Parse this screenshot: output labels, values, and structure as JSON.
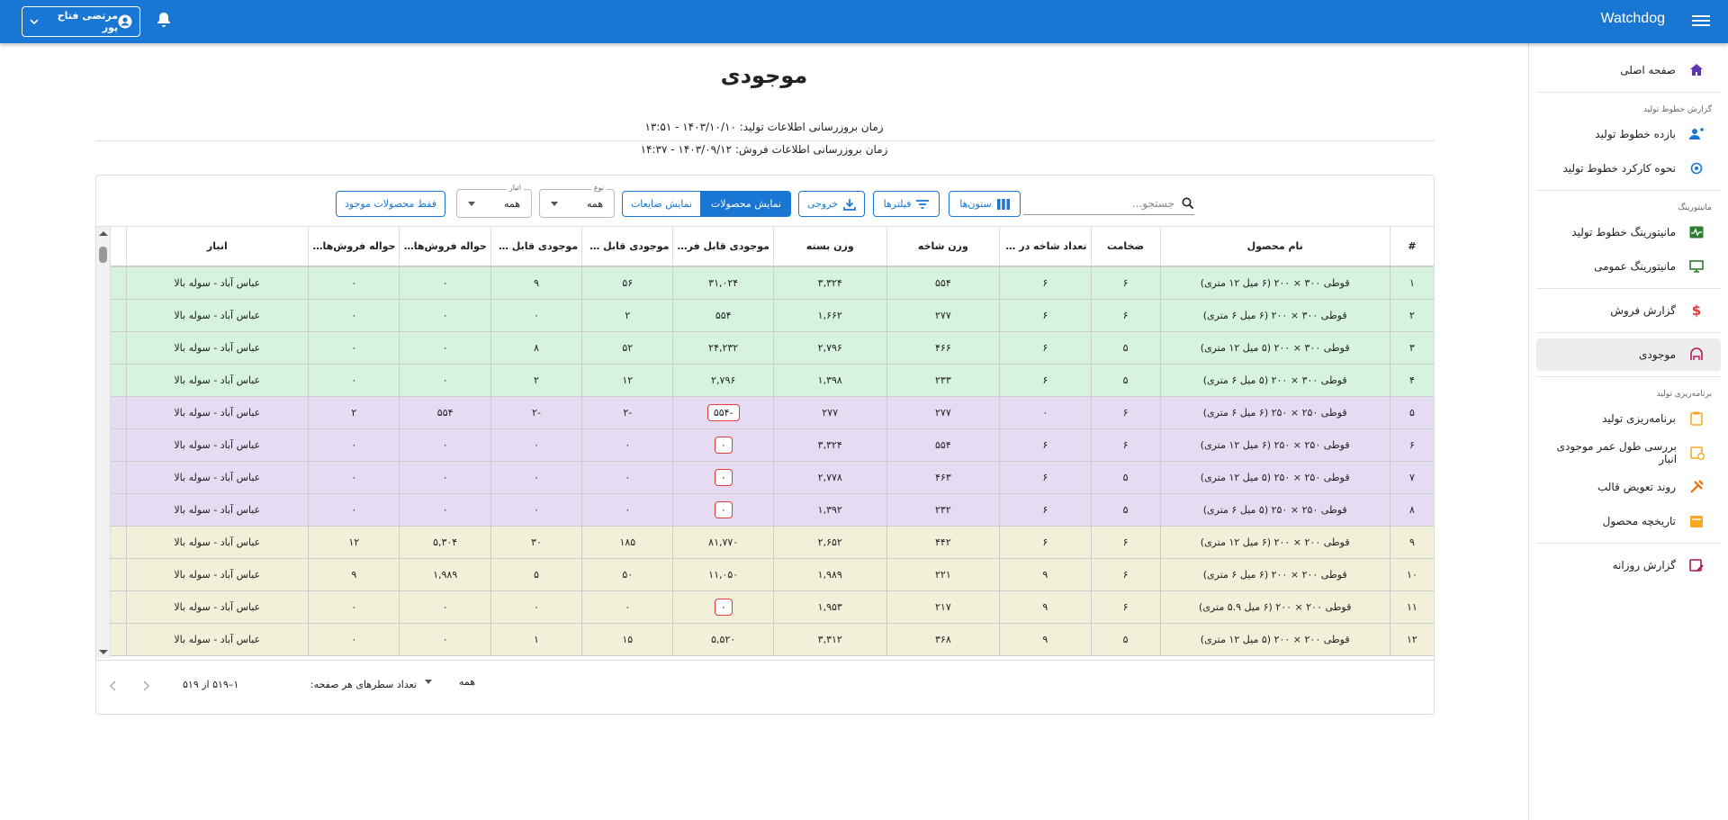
{
  "header": {
    "brand": "Watchdog",
    "user_name": "مرتضی فتاح پور"
  },
  "sidebar": {
    "home": "صفحه اصلی",
    "section1": "گزارش خطوط تولید",
    "item_efficiency": "بازده خطوط تولید",
    "item_operation": "نحوه کارکرد خطوط تولید",
    "section2": "مانیتورینگ",
    "item_mon_lines": "مانیتورینگ خطوط تولید",
    "item_mon_general": "مانیتورینگ عمومی",
    "item_sales": "گزارش فروش",
    "item_stock": "موجودی",
    "section3": "برنامه‌ریزی تولید",
    "item_planning": "برنامه‌ریزی تولید",
    "item_age": "بررسی طول عمر موجودی انبار",
    "item_mold": "روند تعویض قالب",
    "item_history": "تاریخچه محصول",
    "item_daily": "گزارش روزانه"
  },
  "page": {
    "title": "موجودی",
    "update_production": "زمان بروزرسانی اطلاعات تولید: ۱۴۰۳/۱۰/۱۰ - ۱۳:۵۱",
    "update_sales": "زمان بروزرسانی اطلاعات فروش: ۱۴۰۳/۰۹/۱۲ - ۱۴:۳۷"
  },
  "toolbar": {
    "search_placeholder": "جستجو...",
    "columns": "ستون‌ها",
    "filters": "فیلترها",
    "export": "خروجی",
    "show_products": "نمایش محصولات",
    "show_waste": "نمایش ضایعات",
    "type_label": "نوع",
    "type_value": "همه",
    "warehouse_label": "انبار",
    "warehouse_value": "همه",
    "only_available": "فقط محصولات موجود"
  },
  "table": {
    "headers": [
      "#",
      "نام محصول",
      "ضخامت",
      "تعداد شاخه در ب...",
      "وزن شاخه",
      "وزن بسته",
      "موجودی قابل فروش ...",
      "موجودی قابل فر...",
      "موجودی قابل فر...",
      "حواله فروش‌های...",
      "حواله فروش‌های...",
      "انبار"
    ],
    "rows": [
      {
        "c": "g",
        "n": "۱",
        "name": "قوطی ۳۰۰ × ۲۰۰ (۶ میل ۱۲ متری)",
        "t": "۶",
        "b": "۶",
        "bw": "۵۵۴",
        "pw": "۳,۳۲۴",
        "s1": "۳۱,۰۲۴",
        "s1neg": false,
        "s2": "۵۶",
        "s3": "۹",
        "h1": "۰",
        "h2": "۰",
        "w": "عباس آباد - سوله بالا"
      },
      {
        "c": "g",
        "n": "۲",
        "name": "قوطی ۳۰۰ × ۲۰۰ (۶ میل ۶ متری)",
        "t": "۶",
        "b": "۶",
        "bw": "۲۷۷",
        "pw": "۱,۶۶۲",
        "s1": "۵۵۴",
        "s1neg": false,
        "s2": "۲",
        "s3": "۰",
        "h1": "۰",
        "h2": "۰",
        "w": "عباس آباد - سوله بالا"
      },
      {
        "c": "g",
        "n": "۳",
        "name": "قوطی ۳۰۰ × ۲۰۰ (۵ میل ۱۲ متری)",
        "t": "۵",
        "b": "۶",
        "bw": "۴۶۶",
        "pw": "۲,۷۹۶",
        "s1": "۲۴,۲۳۲",
        "s1neg": false,
        "s2": "۵۲",
        "s3": "۸",
        "h1": "۰",
        "h2": "۰",
        "w": "عباس آباد - سوله بالا"
      },
      {
        "c": "g",
        "n": "۴",
        "name": "قوطی ۳۰۰ × ۲۰۰ (۵ میل ۶ متری)",
        "t": "۵",
        "b": "۶",
        "bw": "۲۳۳",
        "pw": "۱,۳۹۸",
        "s1": "۲,۷۹۶",
        "s1neg": false,
        "s2": "۱۲",
        "s3": "۲",
        "h1": "۰",
        "h2": "۰",
        "w": "عباس آباد - سوله بالا"
      },
      {
        "c": "p",
        "n": "۵",
        "name": "قوطی ۲۵۰ × ۲۵۰ (۶ میل ۶ متری)",
        "t": "۶",
        "b": "۰",
        "bw": "۲۷۷",
        "pw": "۲۷۷",
        "s1": "-۵۵۴",
        "s1neg": true,
        "s2": "-۲",
        "s3": "-۲",
        "h1": "۵۵۴",
        "h2": "۲",
        "w": "عباس آباد - سوله بالا"
      },
      {
        "c": "p",
        "n": "۶",
        "name": "قوطی ۲۵۰ × ۲۵۰ (۶ میل ۱۲ متری)",
        "t": "۶",
        "b": "۶",
        "bw": "۵۵۴",
        "pw": "۳,۳۲۴",
        "s1": "۰",
        "s1neg": true,
        "s2": "۰",
        "s3": "۰",
        "h1": "۰",
        "h2": "۰",
        "w": "عباس آباد - سوله بالا"
      },
      {
        "c": "p",
        "n": "۷",
        "name": "قوطی ۲۵۰ × ۲۵۰ (۵ میل ۱۲ متری)",
        "t": "۵",
        "b": "۶",
        "bw": "۴۶۳",
        "pw": "۲,۷۷۸",
        "s1": "۰",
        "s1neg": true,
        "s2": "۰",
        "s3": "۰",
        "h1": "۰",
        "h2": "۰",
        "w": "عباس آباد - سوله بالا"
      },
      {
        "c": "p",
        "n": "۸",
        "name": "قوطی ۲۵۰ × ۲۵۰ (۵ میل ۶ متری)",
        "t": "۵",
        "b": "۶",
        "bw": "۲۳۲",
        "pw": "۱,۳۹۲",
        "s1": "۰",
        "s1neg": true,
        "s2": "۰",
        "s3": "۰",
        "h1": "۰",
        "h2": "۰",
        "w": "عباس آباد - سوله بالا"
      },
      {
        "c": "y",
        "n": "۹",
        "name": "قوطی ۲۰۰ × ۲۰۰ (۶ میل ۱۲ متری)",
        "t": "۶",
        "b": "۶",
        "bw": "۴۴۲",
        "pw": "۲,۶۵۲",
        "s1": "۸۱,۷۷۰",
        "s1neg": false,
        "s2": "۱۸۵",
        "s3": "۳۰",
        "h1": "۵,۳۰۴",
        "h2": "۱۲",
        "w": "عباس آباد - سوله بالا"
      },
      {
        "c": "y",
        "n": "۱۰",
        "name": "قوطی ۲۰۰ × ۲۰۰ (۶ میل ۶ متری)",
        "t": "۶",
        "b": "۹",
        "bw": "۲۲۱",
        "pw": "۱,۹۸۹",
        "s1": "۱۱,۰۵۰",
        "s1neg": false,
        "s2": "۵۰",
        "s3": "۵",
        "h1": "۱,۹۸۹",
        "h2": "۹",
        "w": "عباس آباد - سوله بالا"
      },
      {
        "c": "y",
        "n": "۱۱",
        "name": "قوطی ۲۰۰ × ۲۰۰ (۶ میل ۵.۹ متری)",
        "t": "۶",
        "b": "۹",
        "bw": "۲۱۷",
        "pw": "۱,۹۵۳",
        "s1": "۰",
        "s1neg": true,
        "s2": "۰",
        "s3": "۰",
        "h1": "۰",
        "h2": "۰",
        "w": "عباس آباد - سوله بالا"
      },
      {
        "c": "y",
        "n": "۱۲",
        "name": "قوطی ۲۰۰ × ۲۰۰ (۵ میل ۱۲ متری)",
        "t": "۵",
        "b": "۹",
        "bw": "۳۶۸",
        "pw": "۳,۳۱۲",
        "s1": "۵,۵۲۰",
        "s1neg": false,
        "s2": "۱۵",
        "s3": "۱",
        "h1": "۰",
        "h2": "۰",
        "w": "عباس آباد - سوله بالا"
      }
    ]
  },
  "footer": {
    "rows_per_page_label": "تعداد سطرهای هر صفحه:",
    "rows_per_page_value": "همه",
    "range": "۱–۵۱۹ از ۵۱۹"
  },
  "colors": {
    "primary": "#1976d2",
    "green_row": "#d6f3dd",
    "purple_row": "#e5dcf3",
    "yellow_row": "#f3f0d9",
    "negative": "#e53935"
  }
}
